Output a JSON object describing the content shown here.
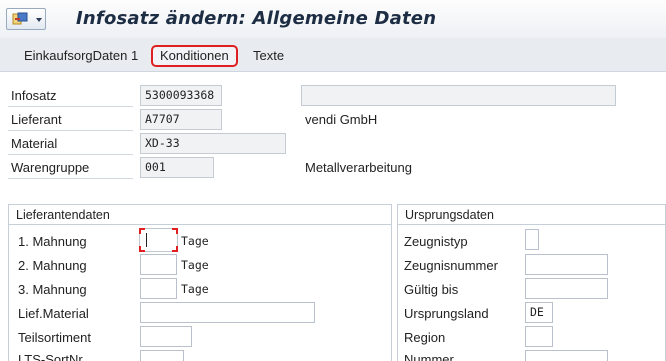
{
  "header": {
    "title": "Infosatz ändern: Allgemeine Daten",
    "app_icon": "menu-icon"
  },
  "tabs": [
    {
      "label": "EinkaufsorgDaten 1",
      "active": false
    },
    {
      "label": "Konditionen",
      "active": true
    },
    {
      "label": "Texte",
      "active": false
    }
  ],
  "general": {
    "infosatz": {
      "label": "Infosatz",
      "value": "5300093368"
    },
    "lieferant": {
      "label": "Lieferant",
      "value": "A7707",
      "description": "vendi GmbH"
    },
    "material": {
      "label": "Material",
      "value": "XD-33"
    },
    "warengruppe": {
      "label": "Warengruppe",
      "value": "001",
      "description": "Metallverarbeitung"
    }
  },
  "lieferantendaten": {
    "title": "Lieferantendaten",
    "mahnung1": {
      "label": "1. Mahnung",
      "value": "",
      "unit": "Tage"
    },
    "mahnung2": {
      "label": "2. Mahnung",
      "value": "",
      "unit": "Tage"
    },
    "mahnung3": {
      "label": "3. Mahnung",
      "value": "",
      "unit": "Tage"
    },
    "lief_material": {
      "label": "Lief.Material",
      "value": ""
    },
    "teilsortiment": {
      "label": "Teilsortiment",
      "value": ""
    },
    "lts_sortnr": {
      "label": "LTS-SortNr",
      "value": ""
    }
  },
  "ursprungsdaten": {
    "title": "Ursprungsdaten",
    "zeugnistyp": {
      "label": "Zeugnistyp",
      "value": ""
    },
    "zeugnisnummer": {
      "label": "Zeugnisnummer",
      "value": ""
    },
    "gueltig_bis": {
      "label": "Gültig bis",
      "value": ""
    },
    "ursprungsland": {
      "label": "Ursprungsland",
      "value": "DE"
    },
    "region": {
      "label": "Region",
      "value": ""
    },
    "nummer": {
      "label": "Nummer",
      "value": ""
    }
  },
  "colors": {
    "highlight": "#e02020",
    "title_text": "#1d2d44",
    "tabbar_bg": "#e8ecf1"
  }
}
